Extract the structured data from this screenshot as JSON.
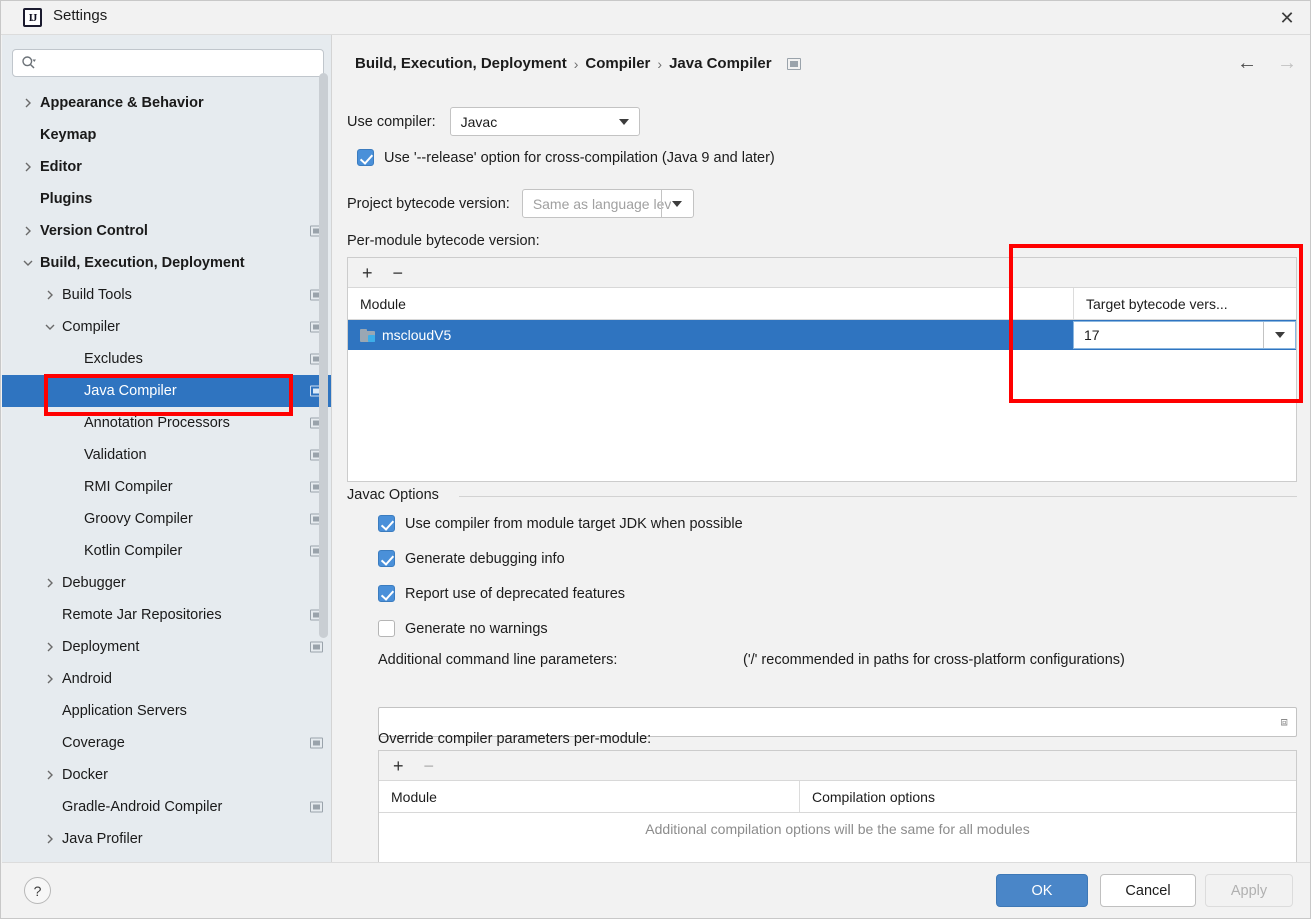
{
  "window": {
    "title": "Settings",
    "app_icon": "intellij-idea-icon",
    "close_icon": "close-icon"
  },
  "sidebar": {
    "search": {
      "placeholder": "",
      "value": "",
      "icon": "search-icon"
    },
    "items": [
      {
        "label": "Appearance & Behavior",
        "indent": 0,
        "twisty": "collapsed",
        "bold": true,
        "selected": false,
        "badge": false
      },
      {
        "label": "Keymap",
        "indent": 0,
        "twisty": "none",
        "bold": true,
        "selected": false,
        "badge": false
      },
      {
        "label": "Editor",
        "indent": 0,
        "twisty": "collapsed",
        "bold": true,
        "selected": false,
        "badge": false
      },
      {
        "label": "Plugins",
        "indent": 0,
        "twisty": "none",
        "bold": true,
        "selected": false,
        "badge": false
      },
      {
        "label": "Version Control",
        "indent": 0,
        "twisty": "collapsed",
        "bold": true,
        "selected": false,
        "badge": true
      },
      {
        "label": "Build, Execution, Deployment",
        "indent": 0,
        "twisty": "expanded",
        "bold": true,
        "selected": false,
        "badge": false
      },
      {
        "label": "Build Tools",
        "indent": 1,
        "twisty": "collapsed",
        "bold": false,
        "selected": false,
        "badge": true
      },
      {
        "label": "Compiler",
        "indent": 1,
        "twisty": "expanded",
        "bold": false,
        "selected": false,
        "badge": true
      },
      {
        "label": "Excludes",
        "indent": 2,
        "twisty": "none",
        "bold": false,
        "selected": false,
        "badge": true
      },
      {
        "label": "Java Compiler",
        "indent": 2,
        "twisty": "none",
        "bold": false,
        "selected": true,
        "badge": true
      },
      {
        "label": "Annotation Processors",
        "indent": 2,
        "twisty": "none",
        "bold": false,
        "selected": false,
        "badge": true
      },
      {
        "label": "Validation",
        "indent": 2,
        "twisty": "none",
        "bold": false,
        "selected": false,
        "badge": true
      },
      {
        "label": "RMI Compiler",
        "indent": 2,
        "twisty": "none",
        "bold": false,
        "selected": false,
        "badge": true
      },
      {
        "label": "Groovy Compiler",
        "indent": 2,
        "twisty": "none",
        "bold": false,
        "selected": false,
        "badge": true
      },
      {
        "label": "Kotlin Compiler",
        "indent": 2,
        "twisty": "none",
        "bold": false,
        "selected": false,
        "badge": true
      },
      {
        "label": "Debugger",
        "indent": 1,
        "twisty": "collapsed",
        "bold": false,
        "selected": false,
        "badge": false
      },
      {
        "label": "Remote Jar Repositories",
        "indent": 1,
        "twisty": "none",
        "bold": false,
        "selected": false,
        "badge": true
      },
      {
        "label": "Deployment",
        "indent": 1,
        "twisty": "collapsed",
        "bold": false,
        "selected": false,
        "badge": true
      },
      {
        "label": "Android",
        "indent": 1,
        "twisty": "collapsed",
        "bold": false,
        "selected": false,
        "badge": false
      },
      {
        "label": "Application Servers",
        "indent": 1,
        "twisty": "none",
        "bold": false,
        "selected": false,
        "badge": false
      },
      {
        "label": "Coverage",
        "indent": 1,
        "twisty": "none",
        "bold": false,
        "selected": false,
        "badge": true
      },
      {
        "label": "Docker",
        "indent": 1,
        "twisty": "collapsed",
        "bold": false,
        "selected": false,
        "badge": false
      },
      {
        "label": "Gradle-Android Compiler",
        "indent": 1,
        "twisty": "none",
        "bold": false,
        "selected": false,
        "badge": true
      },
      {
        "label": "Java Profiler",
        "indent": 1,
        "twisty": "collapsed",
        "bold": false,
        "selected": false,
        "badge": false
      }
    ]
  },
  "main": {
    "breadcrumb": {
      "parts": [
        "Build, Execution, Deployment",
        "Compiler",
        "Java Compiler"
      ],
      "separator": "›",
      "badge": "module-scope-badge"
    },
    "nav": {
      "back_icon": "arrow-left-icon",
      "forward_icon": "arrow-right-icon"
    },
    "use_compiler": {
      "label": "Use compiler:",
      "value": "Javac"
    },
    "release_option": {
      "label": "Use '--release' option for cross-compilation (Java 9 and later)",
      "checked": true
    },
    "project_bytecode": {
      "label": "Project bytecode version:",
      "placeholder": "Same as language lev"
    },
    "per_module": {
      "label": "Per-module bytecode version:",
      "add_icon": "+",
      "remove_icon": "−",
      "columns": [
        "Module",
        "Target bytecode vers..."
      ],
      "rows": [
        {
          "module": "mscloudV5",
          "target": "17",
          "selected": true,
          "icon": "module-folder-icon"
        }
      ]
    },
    "javac_options": {
      "legend": "Javac Options",
      "checkboxes": [
        {
          "label": "Use compiler from module target JDK when possible",
          "checked": true
        },
        {
          "label": "Generate debugging info",
          "checked": true
        },
        {
          "label": "Report use of deprecated features",
          "checked": true
        },
        {
          "label": "Generate no warnings",
          "checked": false
        }
      ],
      "additional_params": {
        "label": "Additional command line parameters:",
        "hint": "('/' recommended in paths for cross-platform configurations)",
        "value": "",
        "expand_icon": "expand-icon"
      },
      "override_params": {
        "label": "Override compiler parameters per-module:",
        "add_icon": "+",
        "remove_icon": "−",
        "columns": [
          "Module",
          "Compilation options"
        ],
        "empty_message": "Additional compilation options will be the same for all modules"
      }
    }
  },
  "footer": {
    "help_label": "?",
    "ok_label": "OK",
    "cancel_label": "Cancel",
    "apply_label": "Apply"
  },
  "annotations": {
    "highlight_color": "#ff0000",
    "boxes": [
      "sidebar-java-compiler-highlight",
      "target-bytecode-column-highlight"
    ]
  },
  "colors": {
    "selection_blue": "#2f74c0",
    "accent_button": "#4a86c8",
    "checkbox_blue": "#4a90d9",
    "sidebar_bg": "#e6ebef",
    "panel_bg": "#f2f2f2"
  }
}
